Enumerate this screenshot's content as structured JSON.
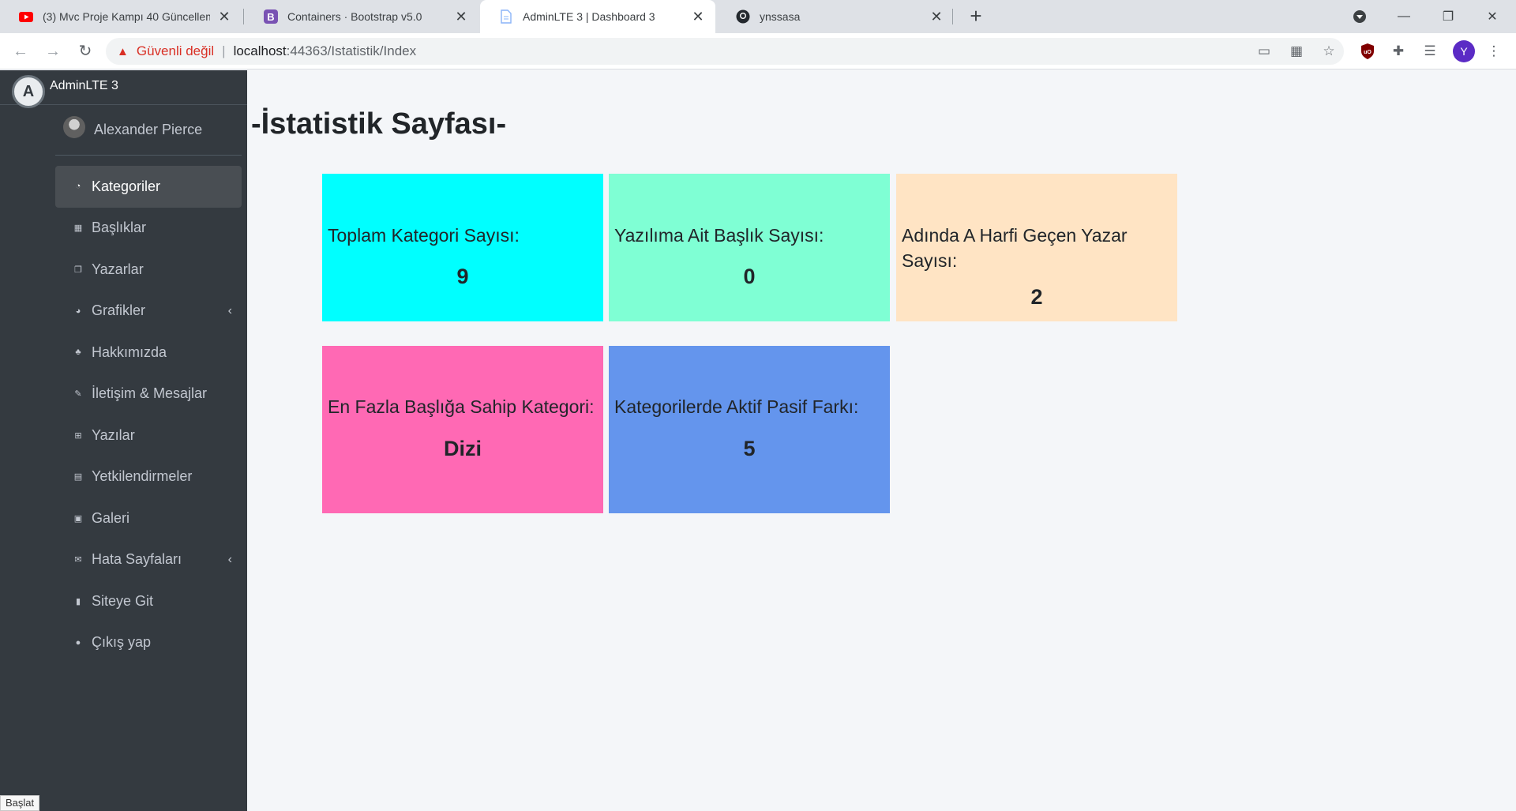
{
  "browser": {
    "tabs": [
      {
        "title": "(3) Mvc Proje Kampı 40 Güncelleme",
        "favicon": "youtube-icon"
      },
      {
        "title": "Containers · Bootstrap v5.0",
        "favicon": "bootstrap-icon"
      },
      {
        "title": "AdminLTE 3 | Dashboard 3",
        "favicon": "document-icon",
        "active": true
      },
      {
        "title": "ynssasa",
        "favicon": "github-icon"
      }
    ],
    "security_warning": "Güvenli değil",
    "url_host": "localhost",
    "url_path": ":44363/Istatistik/Index",
    "profile_initial": "Y",
    "colors": {
      "warning": "#d93025",
      "profile": "#5b2bc5"
    }
  },
  "sidebar": {
    "brand": "AdminLTE 3",
    "user": "Alexander Pierce",
    "items": [
      {
        "label": "Kategoriler",
        "icon": "dashboard-icon"
      },
      {
        "label": "Başlıklar",
        "icon": "grid-icon"
      },
      {
        "label": "Yazarlar",
        "icon": "copy-icon"
      },
      {
        "label": "Grafikler",
        "icon": "pie-chart-icon"
      },
      {
        "label": "Hakkımızda",
        "icon": "tree-icon"
      },
      {
        "label": "İletişim & Mesajlar",
        "icon": "edit-icon"
      },
      {
        "label": "Yazılar",
        "icon": "table-icon"
      },
      {
        "label": "Yetkilendirmeler",
        "icon": "calendar-icon"
      },
      {
        "label": "Galeri",
        "icon": "image-icon"
      },
      {
        "label": "Hata Sayfaları",
        "icon": "envelope-icon"
      },
      {
        "label": "Siteye Git",
        "icon": "book-icon"
      },
      {
        "label": "Çıkış yap",
        "icon": "apple-icon"
      }
    ],
    "status_text": "Başlat"
  },
  "main": {
    "title": "-İstatistik Sayfası-",
    "stats": [
      {
        "label": "Toplam Kategori Sayısı:",
        "value": "9",
        "color": "#00ffff"
      },
      {
        "label": "Yazılıma Ait Başlık Sayısı:",
        "value": "0",
        "color": "#7fffd4"
      },
      {
        "label": "Adında A Harfi Geçen Yazar Sayısı:",
        "value": "2",
        "color": "#ffe4c4"
      },
      {
        "label": "En Fazla Başlığa Sahip Kategori:",
        "value": "Dizi",
        "color": "#ff69b4"
      },
      {
        "label": "Kategorilerde Aktif Pasif Farkı:",
        "value": "5",
        "color": "#6495ed"
      }
    ]
  }
}
